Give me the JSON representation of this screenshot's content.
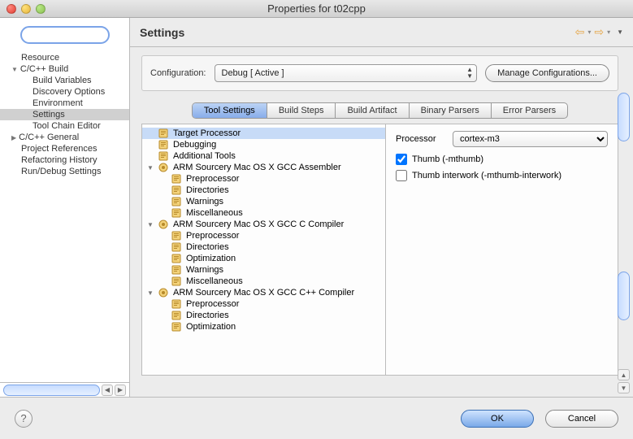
{
  "window": {
    "title": "Properties for t02cpp"
  },
  "left_nav": {
    "items": [
      {
        "label": "Resource",
        "level": 0
      },
      {
        "label": "C/C++ Build",
        "level": 0,
        "expanded": true
      },
      {
        "label": "Build Variables",
        "level": 1
      },
      {
        "label": "Discovery Options",
        "level": 1
      },
      {
        "label": "Environment",
        "level": 1
      },
      {
        "label": "Settings",
        "level": 1,
        "selected": true
      },
      {
        "label": "Tool Chain Editor",
        "level": 1
      },
      {
        "label": "C/C++ General",
        "level": 0,
        "collapsed": true
      },
      {
        "label": "Project References",
        "level": 0
      },
      {
        "label": "Refactoring History",
        "level": 0
      },
      {
        "label": "Run/Debug Settings",
        "level": 0
      }
    ]
  },
  "header": {
    "title": "Settings"
  },
  "config": {
    "label": "Configuration:",
    "value": "Debug  [ Active ]",
    "manage_label": "Manage Configurations..."
  },
  "tabs": {
    "items": [
      "Tool Settings",
      "Build Steps",
      "Build Artifact",
      "Binary Parsers",
      "Error Parsers"
    ],
    "active": "Tool Settings"
  },
  "tool_tree": [
    {
      "label": "Target Processor",
      "level": 0,
      "icon": "doc",
      "selected": true
    },
    {
      "label": "Debugging",
      "level": 0,
      "icon": "doc"
    },
    {
      "label": "Additional Tools",
      "level": 0,
      "icon": "doc"
    },
    {
      "label": "ARM Sourcery Mac OS X GCC Assembler",
      "level": 0,
      "icon": "tool",
      "expanded": true
    },
    {
      "label": "Preprocessor",
      "level": 1,
      "icon": "doc"
    },
    {
      "label": "Directories",
      "level": 1,
      "icon": "doc"
    },
    {
      "label": "Warnings",
      "level": 1,
      "icon": "doc"
    },
    {
      "label": "Miscellaneous",
      "level": 1,
      "icon": "doc"
    },
    {
      "label": "ARM Sourcery Mac OS X GCC C Compiler",
      "level": 0,
      "icon": "tool",
      "expanded": true
    },
    {
      "label": "Preprocessor",
      "level": 1,
      "icon": "doc"
    },
    {
      "label": "Directories",
      "level": 1,
      "icon": "doc"
    },
    {
      "label": "Optimization",
      "level": 1,
      "icon": "doc"
    },
    {
      "label": "Warnings",
      "level": 1,
      "icon": "doc"
    },
    {
      "label": "Miscellaneous",
      "level": 1,
      "icon": "doc"
    },
    {
      "label": "ARM Sourcery Mac OS X GCC C++ Compiler",
      "level": 0,
      "icon": "tool",
      "expanded": true
    },
    {
      "label": "Preprocessor",
      "level": 1,
      "icon": "doc"
    },
    {
      "label": "Directories",
      "level": 1,
      "icon": "doc"
    },
    {
      "label": "Optimization",
      "level": 1,
      "icon": "doc"
    }
  ],
  "props": {
    "processor_label": "Processor",
    "processor_value": "cortex-m3",
    "thumb_label": "Thumb (-mthumb)",
    "thumb_checked": true,
    "interwork_label": "Thumb interwork (-mthumb-interwork)",
    "interwork_checked": false
  },
  "footer": {
    "ok": "OK",
    "cancel": "Cancel"
  }
}
